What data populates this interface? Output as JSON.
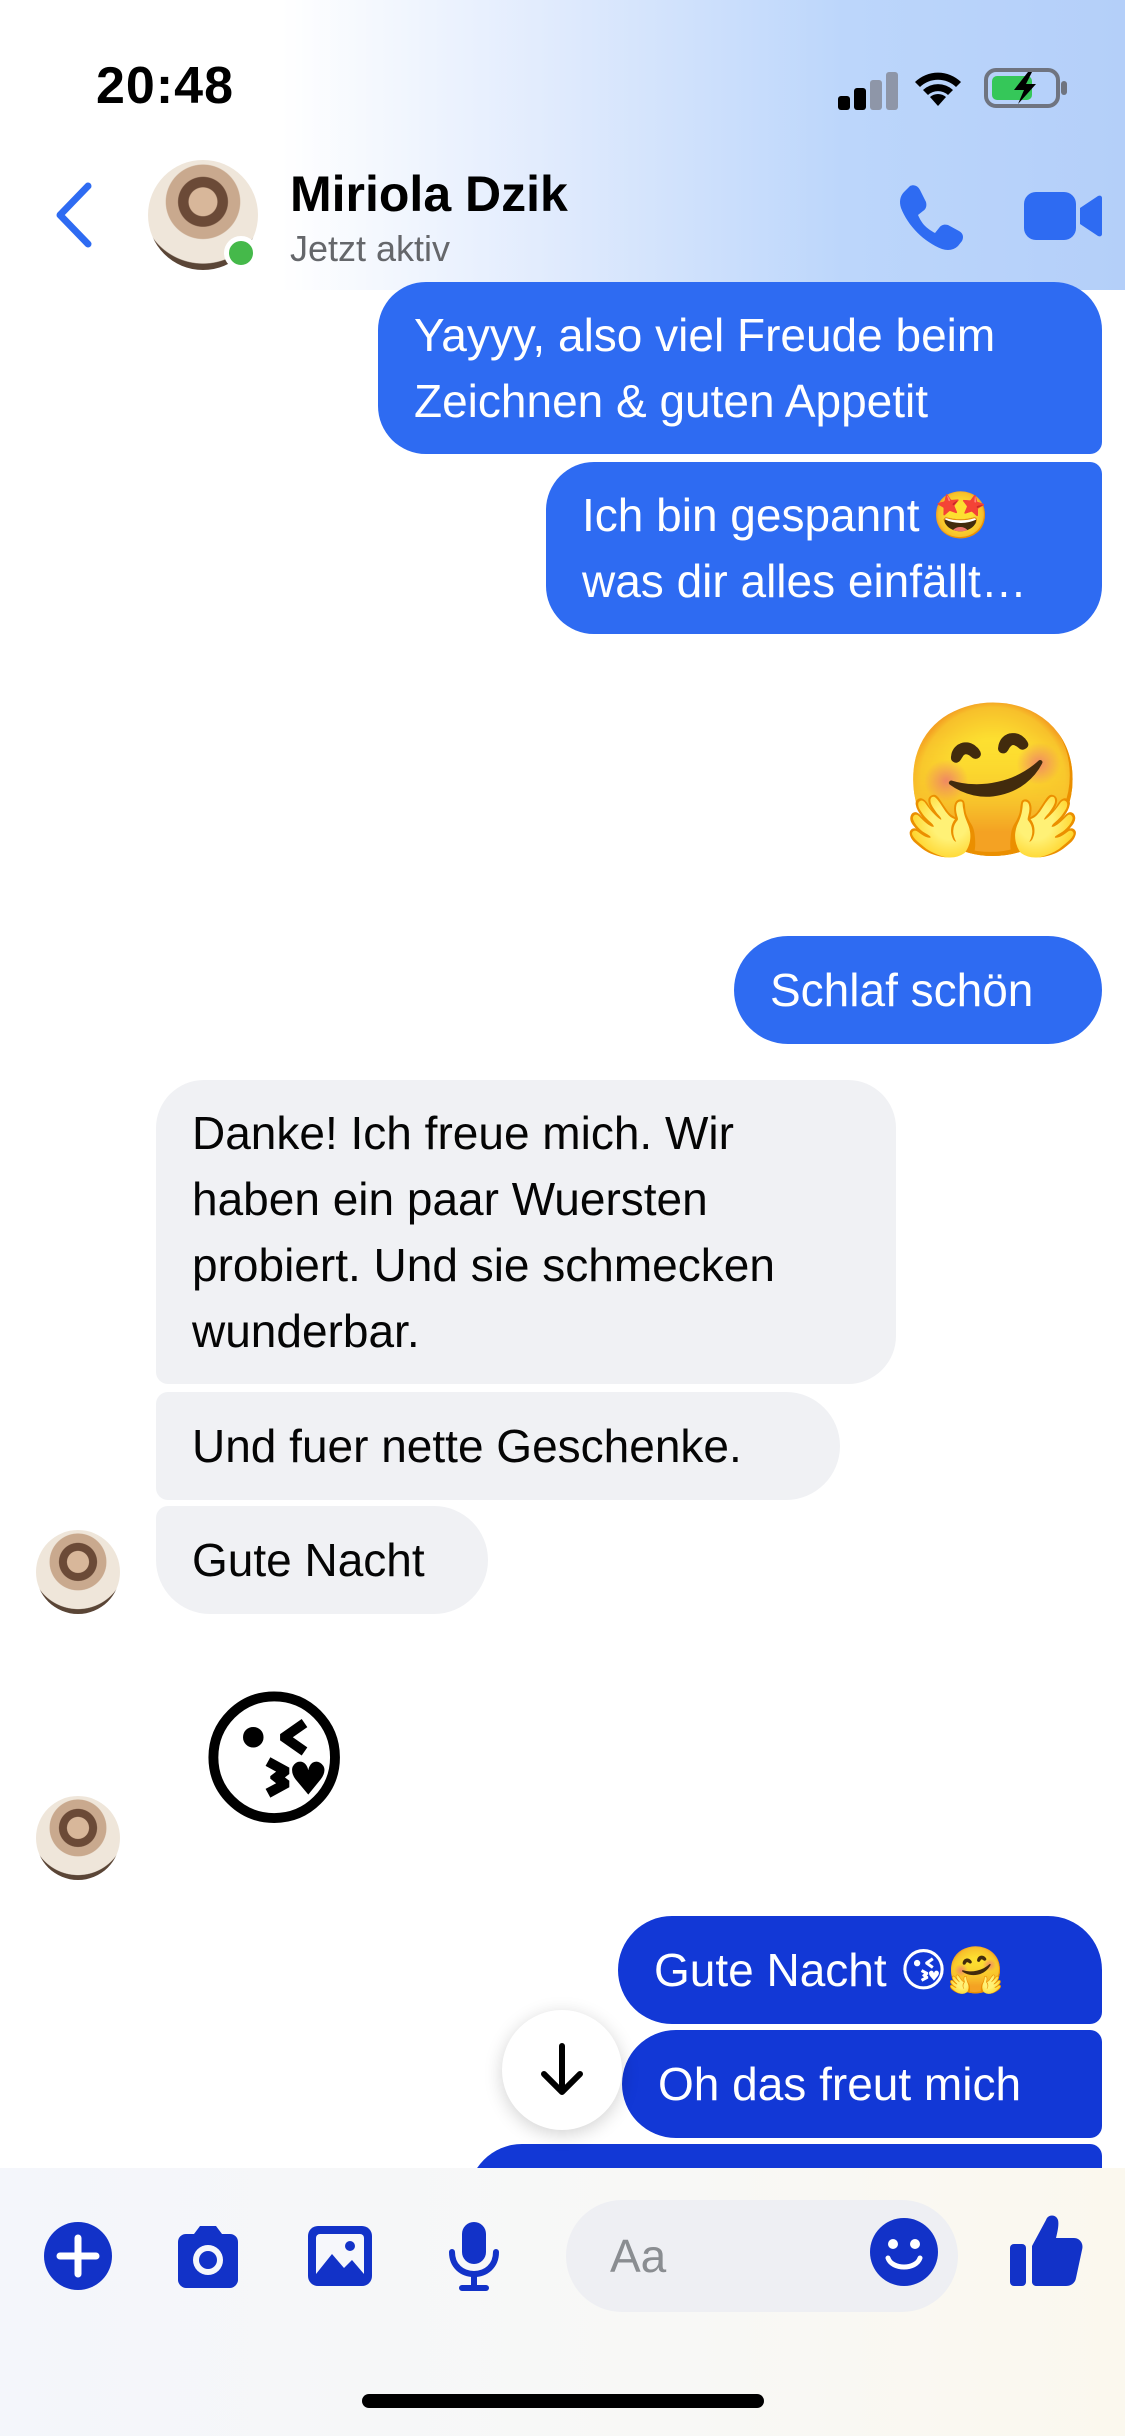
{
  "status_bar": {
    "time": "20:48"
  },
  "header": {
    "contact_name": "Miriola Dzik",
    "status": "Jetzt aktiv"
  },
  "messages": {
    "m1": "Yayyy, also viel Freude beim\nZeichnen & guten Appetit",
    "m2": "Ich bin gespannt 🤩\nwas dir alles einfällt…",
    "m3_emoji": "🤗",
    "m4": "Schlaf schön",
    "m5": "Danke! Ich freue mich. Wir\nhaben ein paar Wuersten\nprobiert. Und sie schmecken\nwunderbar.",
    "m6": "Und fuer nette Geschenke.",
    "m7": "Gute Nacht",
    "m8_emoji": "😘",
    "m9": "Gute Nacht 😘🤗",
    "m10": "Oh das freut mich"
  },
  "composer": {
    "placeholder": "Aa"
  },
  "colors": {
    "accent": "#2e6bf2",
    "accent_dark": "#1238d6",
    "incoming_bubble": "#f0f1f4",
    "online": "#45b94a",
    "icon_blue": "#1232c8"
  },
  "icons": [
    "back-chevron-icon",
    "phone-icon",
    "video-camera-icon",
    "plus-icon",
    "camera-icon",
    "gallery-icon",
    "microphone-icon",
    "emoji-face-icon",
    "thumbs-up-icon",
    "arrow-down-icon"
  ]
}
